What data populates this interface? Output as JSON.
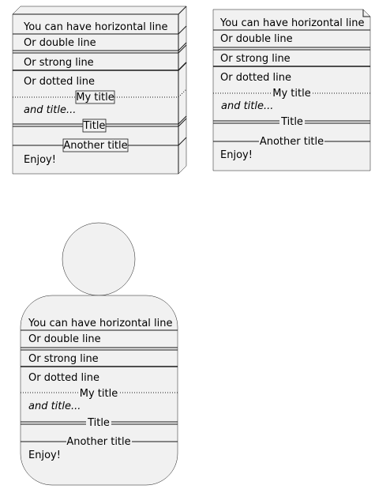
{
  "node": {
    "line1": "You can have horizontal line",
    "line2": "Or double line",
    "line3": "Or strong line",
    "line4": "Or dotted line",
    "title1": "My title",
    "line5": "and title...",
    "title2": "Title",
    "title3": "Another title",
    "line6": "Enjoy!"
  },
  "file": {
    "line1": "You can have horizontal line",
    "line2": "Or double line",
    "line3": "Or strong line",
    "line4": "Or dotted line",
    "title1": "My title",
    "line5": "and title...",
    "title2": "Title",
    "title3": "Another title",
    "line6": "Enjoy!"
  },
  "person": {
    "line1": "You can have horizontal line",
    "line2": "Or double line",
    "line3": "Or strong line",
    "line4": "Or dotted line",
    "title1": "My title",
    "line5": "and title...",
    "title2": "Title",
    "title3": "Another title",
    "line6": "Enjoy!"
  }
}
